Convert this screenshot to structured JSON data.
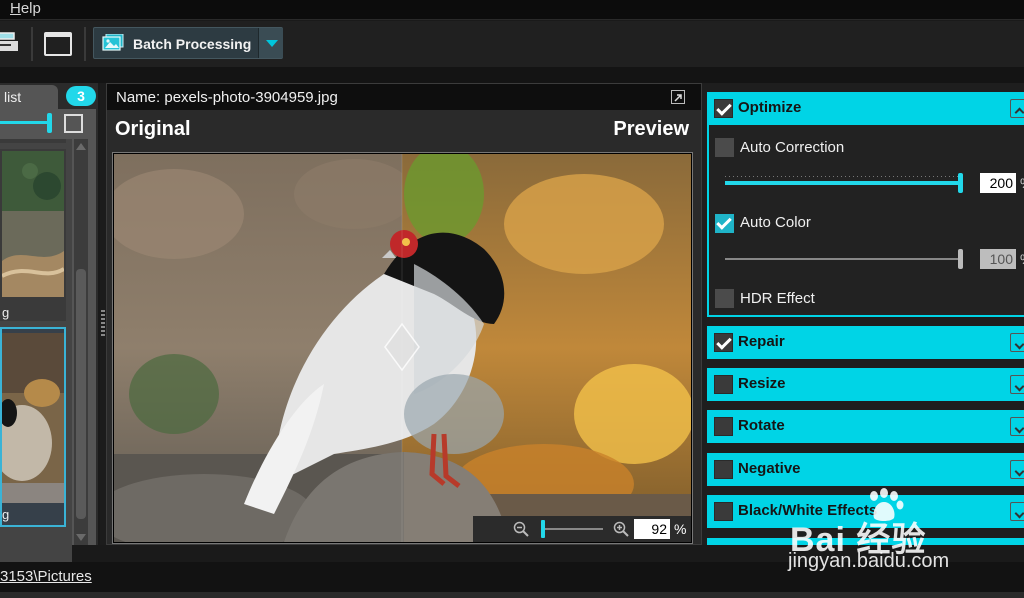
{
  "menu": {
    "help": "Help"
  },
  "toolbar": {
    "batch_label": "Batch Processing"
  },
  "file_list": {
    "tab_label": "list",
    "count": "3",
    "thumbs": [
      {
        "label": "g"
      },
      {
        "label": "g"
      }
    ]
  },
  "preview": {
    "name": "Name: pexels-photo-3904959.jpg",
    "original_label": "Original",
    "preview_label": "Preview",
    "zoom_value": "92",
    "zoom_unit": "%"
  },
  "panel": {
    "sections": [
      {
        "label": "Optimize",
        "checked": true,
        "expanded": true
      },
      {
        "label": "Repair",
        "checked": true,
        "expanded": false
      },
      {
        "label": "Resize",
        "checked": false,
        "expanded": false
      },
      {
        "label": "Rotate",
        "checked": false,
        "expanded": false
      },
      {
        "label": "Negative",
        "checked": false,
        "expanded": false
      },
      {
        "label": "Black/White Effects",
        "checked": false,
        "expanded": false
      }
    ],
    "optimize": {
      "auto_correction": {
        "label": "Auto Correction",
        "checked": false,
        "value": "200",
        "unit": "%",
        "level": 1.0
      },
      "auto_color": {
        "label": "Auto Color",
        "checked": true,
        "value": "100",
        "unit": "%",
        "level": 1.0
      },
      "hdr": {
        "label": "HDR Effect",
        "checked": false
      }
    }
  },
  "status": {
    "path": "3153\\Pictures"
  },
  "watermark": {
    "cn": "Bai 经验",
    "url": "jingyan.baidu.com"
  },
  "colors": {
    "accent": "#00d4e6",
    "background": "#1a1a1a"
  }
}
